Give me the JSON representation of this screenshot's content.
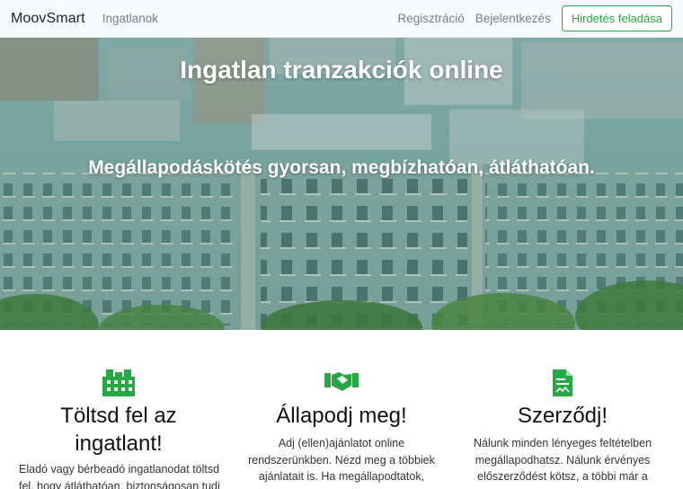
{
  "navbar": {
    "brand": "MoovSmart",
    "links": [
      "Ingatlanok",
      "Regisztráció",
      "Bejelentkezés"
    ],
    "cta_label": "Hirdetés feladása"
  },
  "hero": {
    "title": "Ingatlan tranzakciók online",
    "subtitle": "Megállapodáskötés gyorsan, megbízhatóan, átláthatóan."
  },
  "features": [
    {
      "icon": "building-icon",
      "title": "Töltsd fel az ingatlant!",
      "text": "Eladó vagy bérbeadó ingatlanodat töltsd fel, hogy átláthatóan, biztonságosan tudj"
    },
    {
      "icon": "handshake-icon",
      "title": "Állapodj meg!",
      "text": "Adj (ellen)ajánlatot online rendszerünkben. Nézd meg a többiek ajánlatait is. Ha megállapodtatok,"
    },
    {
      "icon": "contract-icon",
      "title": "Szerződj!",
      "text": "Nálunk minden lényeges feltételben megállapodhatsz. Nálunk érvényes előszerződést kötsz, a többi már a"
    }
  ],
  "colors": {
    "accent": "#28a745",
    "navbar_bg": "#f8f9fa"
  }
}
